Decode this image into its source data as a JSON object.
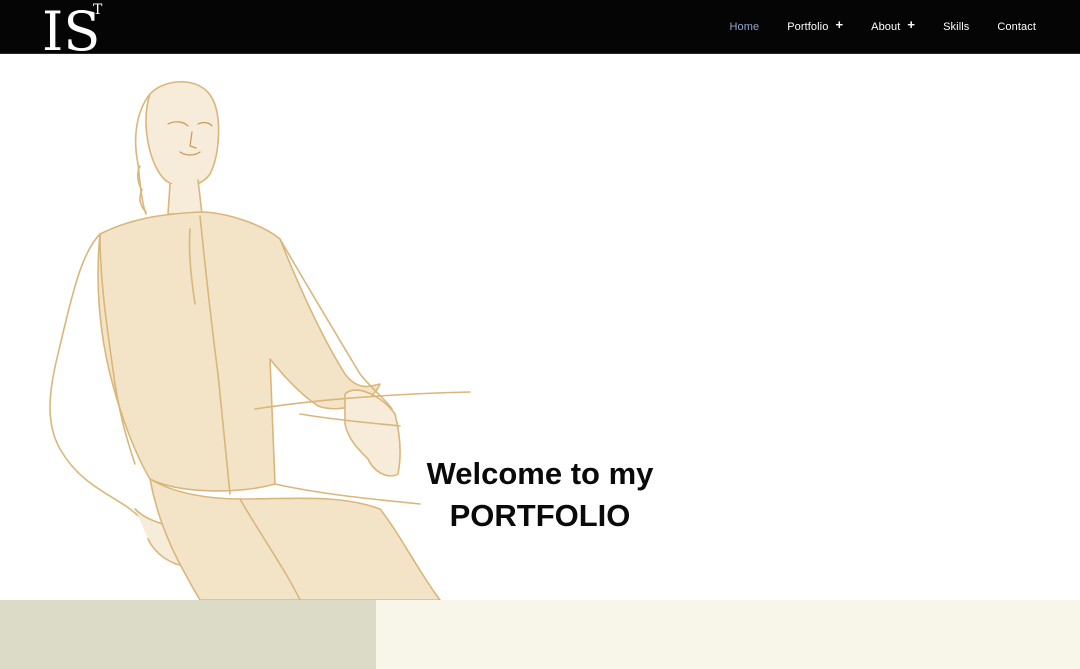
{
  "brand": {
    "logo_text": "IS",
    "logo_superscript": "T"
  },
  "nav": {
    "items": [
      {
        "label": "Home",
        "active": true,
        "has_submenu": false
      },
      {
        "label": "Portfolio",
        "active": false,
        "has_submenu": true
      },
      {
        "label": "About",
        "active": false,
        "has_submenu": true
      },
      {
        "label": "Skills",
        "active": false,
        "has_submenu": false
      },
      {
        "label": "Contact",
        "active": false,
        "has_submenu": false
      }
    ],
    "submenu_glyph": "+"
  },
  "hero": {
    "title_line1": "Welcome to my",
    "title_line2": "PORTFOLIO",
    "illustration": "fashion-sketch-seated-figure"
  },
  "colors": {
    "header_bg": "#050505",
    "nav_active": "#93a6cf",
    "sketch_line": "#d8b373",
    "sketch_fill": "#f3e3c6",
    "strip_left": "#dcdbc8",
    "strip_right": "#f8f6e9"
  }
}
